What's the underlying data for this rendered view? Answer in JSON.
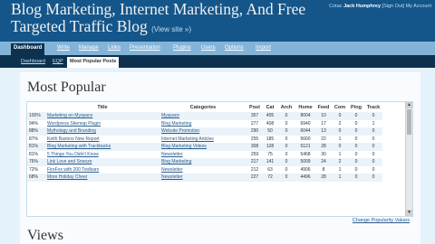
{
  "header": {
    "title": "Blog Marketing, Internet Marketing, And Free Targeted Traffic Blog",
    "view_site": "(View site »)",
    "user_prefix": "Cotac",
    "user_name": "Jack Humphrey",
    "sign_out": "Sign Out",
    "my_account": "My Account"
  },
  "nav": [
    {
      "label": "Dashboard"
    },
    {
      "label": "Write"
    },
    {
      "label": "Manage"
    },
    {
      "label": "Links"
    },
    {
      "label": "Presentation"
    },
    {
      "label": "Plugins"
    },
    {
      "label": "Users"
    },
    {
      "label": "Options"
    },
    {
      "label": "Import"
    }
  ],
  "subnav": [
    {
      "label": "Dashboard"
    },
    {
      "label": "EQP"
    },
    {
      "label": "Most Popular Posts"
    }
  ],
  "popular": {
    "heading": "Most Popular",
    "columns": [
      "Title",
      "Categories",
      "Post",
      "Cat",
      "Arch",
      "Home",
      "Feed",
      "Com",
      "Ping",
      "Track"
    ],
    "rows": [
      [
        "100%",
        "Marketing on Myspace",
        "Myspace",
        "357",
        "405",
        "0",
        "8004",
        "10",
        "0",
        "0",
        "0"
      ],
      [
        "94%",
        "Wordpress Sitemap Plugin",
        "Blog Marketing",
        "277",
        "408",
        "0",
        "6940",
        "17",
        "2",
        "0",
        "1"
      ],
      [
        "88%",
        "Mythology and Branding",
        "Website Promotion",
        "290",
        "50",
        "0",
        "6044",
        "13",
        "0",
        "0",
        "0"
      ],
      [
        "87%",
        "Keith Baxters New Report",
        "Internet Marketing Articles",
        "255",
        "185",
        "0",
        "5660",
        "22",
        "1",
        "0",
        "0"
      ],
      [
        "81%",
        "Blog Marketing with Trackbacks",
        "Blog Marketing Videos",
        "308",
        "128",
        "0",
        "5121",
        "28",
        "0",
        "0",
        "0"
      ],
      [
        "81%",
        "5 Things You Didn't Know",
        "Newsletter",
        "259",
        "75",
        "0",
        "5468",
        "30",
        "1",
        "0",
        "0"
      ],
      [
        "76%",
        "Link Love and Snooze",
        "Blog Marketing",
        "217",
        "141",
        "0",
        "5009",
        "24",
        "2",
        "0",
        "0"
      ],
      [
        "72%",
        "FireFox with 200 Toolbars",
        "Newsletter",
        "212",
        "63",
        "0",
        "4906",
        "8",
        "1",
        "0",
        "0"
      ],
      [
        "68%",
        "More Holiday Cheer",
        "Newsletter",
        "227",
        "72",
        "0",
        "4496",
        "28",
        "1",
        "0",
        "0"
      ],
      [
        "",
        "",
        "",
        "",
        "",
        "",
        "",
        "",
        "",
        "",
        ""
      ]
    ],
    "change_link": "Change Popularity Values"
  },
  "views": {
    "heading": "Views"
  },
  "icons": {
    "scroll_up": "▲",
    "scroll_down": "▼"
  },
  "colors": {
    "header_bg": "#14568a",
    "nav_bg": "#83b4d8",
    "subnav_bg": "#0d324f",
    "link": "#2a5a8a"
  }
}
